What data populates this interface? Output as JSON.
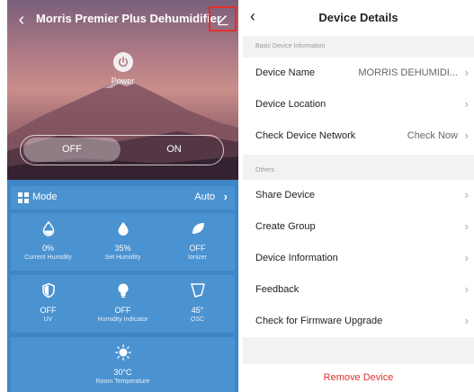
{
  "left": {
    "title": "Morris Premier Plus Dehumidifier",
    "power_label": "Power",
    "toggle": {
      "off_label": "OFF",
      "on_label": "ON"
    },
    "mode": {
      "label": "Mode",
      "value": "Auto"
    },
    "cells": [
      {
        "value": "0%",
        "label": "Current Humidity",
        "icon": "droplet-outline-icon"
      },
      {
        "value": "35%",
        "label": "Set Humidity",
        "icon": "droplet-icon"
      },
      {
        "value": "OFF",
        "label": "Ionizer",
        "icon": "leaf-icon"
      },
      {
        "value": "OFF",
        "label": "UV",
        "icon": "shield-icon"
      },
      {
        "value": "OFF",
        "label": "Humidity Indicator",
        "icon": "bulb-icon"
      },
      {
        "value": "45°",
        "label": "OSC",
        "icon": "fan-oscillate-icon"
      },
      {
        "value": "30°C",
        "label": "Room Temperature",
        "icon": "sun-icon"
      }
    ]
  },
  "right": {
    "title": "Device Details",
    "section_basic": "Basic Device Information",
    "device_name_label": "Device Name",
    "device_name_value": "MORRIS DEHUMIDI...",
    "device_location_label": "Device Location",
    "check_network_label": "Check Device Network",
    "check_network_value": "Check Now",
    "section_others": "Others",
    "share_device": "Share Device",
    "create_group": "Create Group",
    "device_information": "Device Information",
    "feedback": "Feedback",
    "firmware_upgrade": "Check for Firmware Upgrade",
    "remove_device": "Remove Device"
  },
  "colors": {
    "panel_blue": "#3f86c6",
    "card_blue": "#4b92d0",
    "highlight_red": "#e0302a",
    "remove_red": "#e0302a"
  }
}
